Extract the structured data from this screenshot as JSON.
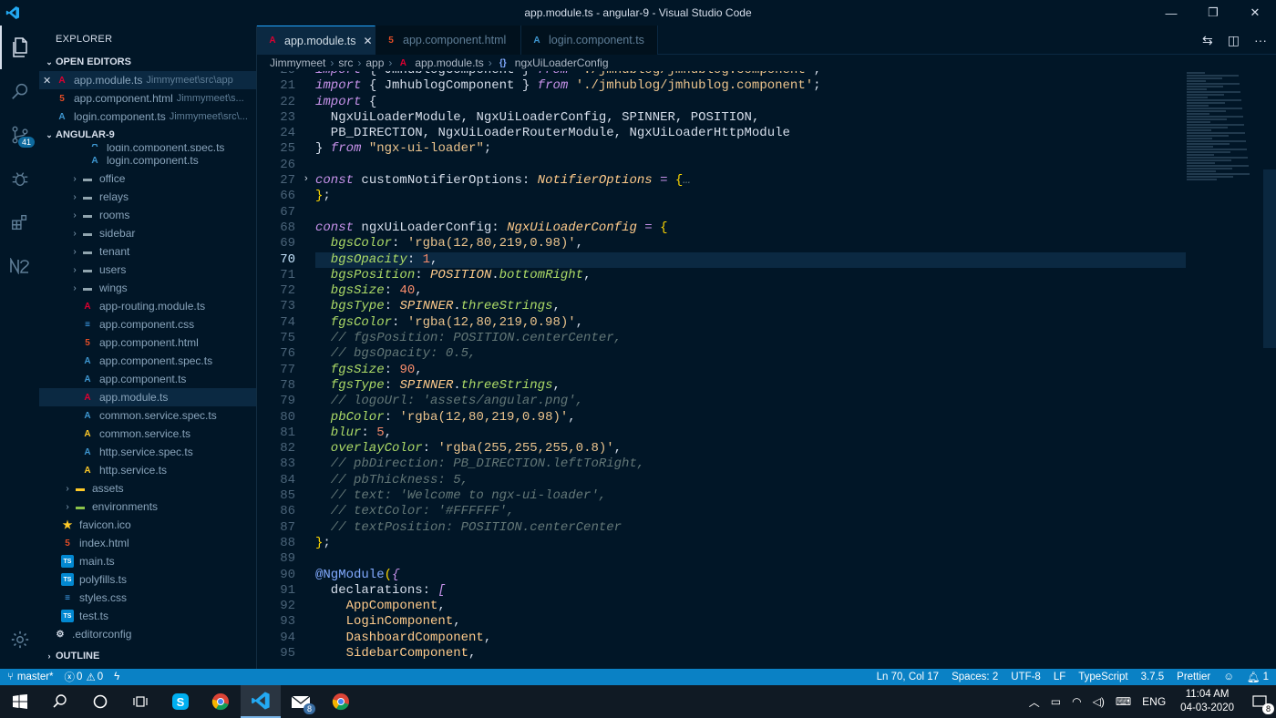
{
  "window": {
    "title": "app.module.ts - angular-9 - Visual Studio Code",
    "minimize": "—",
    "maximize": "❐",
    "close": "✕"
  },
  "activity": {
    "source_control_badge": "41"
  },
  "explorer": {
    "title": "EXPLORER",
    "open_editors_label": "OPEN EDITORS",
    "open_editors": [
      {
        "name": "app.module.ts",
        "path": "Jimmymeet\\src\\app",
        "icon": "angular-icon"
      },
      {
        "name": "app.component.html",
        "path": "Jimmymeet\\s...",
        "icon": "html-icon"
      },
      {
        "name": "login.component.ts",
        "path": "Jimmymeet\\src\\...",
        "icon": "angular-spec-icon"
      }
    ],
    "project_label": "ANGULAR-9",
    "tree": [
      {
        "name": "login.component.spec.ts",
        "indent": 3,
        "icon": "spec"
      },
      {
        "name": "login.component.ts",
        "indent": 3,
        "icon": "spec"
      },
      {
        "name": "office",
        "indent": 2,
        "icon": "folder"
      },
      {
        "name": "relays",
        "indent": 2,
        "icon": "folder"
      },
      {
        "name": "rooms",
        "indent": 2,
        "icon": "folder"
      },
      {
        "name": "sidebar",
        "indent": 2,
        "icon": "folder"
      },
      {
        "name": "tenant",
        "indent": 2,
        "icon": "folder"
      },
      {
        "name": "users",
        "indent": 2,
        "icon": "folder"
      },
      {
        "name": "wings",
        "indent": 2,
        "icon": "folder"
      },
      {
        "name": "app-routing.module.ts",
        "indent": 2,
        "icon": "ng"
      },
      {
        "name": "app.component.css",
        "indent": 2,
        "icon": "css"
      },
      {
        "name": "app.component.html",
        "indent": 2,
        "icon": "html"
      },
      {
        "name": "app.component.spec.ts",
        "indent": 2,
        "icon": "spec"
      },
      {
        "name": "app.component.ts",
        "indent": 2,
        "icon": "spec"
      },
      {
        "name": "app.module.ts",
        "indent": 2,
        "icon": "ng"
      },
      {
        "name": "common.service.spec.ts",
        "indent": 2,
        "icon": "spec"
      },
      {
        "name": "common.service.ts",
        "indent": 2,
        "icon": "svc"
      },
      {
        "name": "http.service.spec.ts",
        "indent": 2,
        "icon": "spec"
      },
      {
        "name": "http.service.ts",
        "indent": 2,
        "icon": "svc"
      },
      {
        "name": "assets",
        "indent": 1,
        "icon": "folder-y"
      },
      {
        "name": "environments",
        "indent": 1,
        "icon": "folder-g"
      },
      {
        "name": "favicon.ico",
        "indent": 1,
        "icon": "star"
      },
      {
        "name": "index.html",
        "indent": 1,
        "icon": "html"
      },
      {
        "name": "main.ts",
        "indent": 1,
        "icon": "ts"
      },
      {
        "name": "polyfills.ts",
        "indent": 1,
        "icon": "ts"
      },
      {
        "name": "styles.css",
        "indent": 1,
        "icon": "css"
      },
      {
        "name": "test.ts",
        "indent": 1,
        "icon": "ts"
      },
      {
        "name": ".editorconfig",
        "indent": 0,
        "icon": "gear"
      }
    ],
    "outline_label": "OUTLINE"
  },
  "tabs": [
    {
      "label": "app.module.ts",
      "icon": "angular-icon",
      "active": true
    },
    {
      "label": "app.component.html",
      "icon": "html-icon",
      "active": false
    },
    {
      "label": "login.component.ts",
      "icon": "angular-spec-icon",
      "active": false
    }
  ],
  "breadcrumbs": [
    "Jimmymeet",
    "src",
    "app",
    "app.module.ts",
    "ngxUiLoaderConfig"
  ],
  "editor": {
    "line_numbers": [
      "20",
      "21",
      "22",
      "23",
      "24",
      "25",
      "26",
      "27",
      "66",
      "67",
      "68",
      "69",
      "70",
      "71",
      "72",
      "73",
      "74",
      "75",
      "76",
      "77",
      "78",
      "79",
      "80",
      "81",
      "82",
      "83",
      "84",
      "85",
      "86",
      "87",
      "88",
      "89",
      "90",
      "91",
      "92",
      "93",
      "94",
      "95"
    ],
    "highlight_line_index": 12,
    "code": [
      [
        [
          "kw",
          "import "
        ],
        [
          "pu",
          "{ "
        ],
        [
          "v",
          "JmhublogComponent"
        ],
        [
          "pu",
          " } "
        ],
        [
          "kw",
          "from "
        ],
        [
          "str",
          "'./jmhublog/jmhublog.component'"
        ],
        [
          "pu",
          ";"
        ]
      ],
      [
        [
          "kw",
          "import "
        ],
        [
          "pu",
          "{ "
        ],
        [
          "v",
          "JmhublogComponent"
        ],
        [
          "pu",
          " } "
        ],
        [
          "kw",
          "from "
        ],
        [
          "str",
          "'./jmhublog/jmhublog.component'"
        ],
        [
          "pu",
          ";"
        ]
      ],
      [
        [
          "kw",
          "import "
        ],
        [
          "pu",
          "{"
        ]
      ],
      [
        [
          "v",
          "  NgxUiLoaderModule"
        ],
        [
          "pu",
          ", "
        ],
        [
          "v",
          "NgxUiLoaderConfig"
        ],
        [
          "pu",
          ", "
        ],
        [
          "v",
          "SPINNER"
        ],
        [
          "pu",
          ", "
        ],
        [
          "v",
          "POSITION"
        ],
        [
          "pu",
          ","
        ]
      ],
      [
        [
          "v",
          "  PB_DIRECTION"
        ],
        [
          "pu",
          ", "
        ],
        [
          "v",
          "NgxUiLoaderRouterModule"
        ],
        [
          "pu",
          ", "
        ],
        [
          "v",
          "NgxUiLoaderHttpModule"
        ]
      ],
      [
        [
          "pu",
          "} "
        ],
        [
          "kw",
          "from "
        ],
        [
          "str",
          "\"ngx-ui-loader\""
        ],
        [
          "pu",
          ";"
        ]
      ],
      [
        [
          "pu",
          ""
        ]
      ],
      [
        [
          "kw",
          "const "
        ],
        [
          "v",
          "customNotifierOptions"
        ],
        [
          "pu",
          ": "
        ],
        [
          "ty",
          "NotifierOptions"
        ],
        [
          "op",
          " = "
        ],
        [
          "br",
          "{"
        ],
        [
          "cm",
          "…"
        ]
      ],
      [
        [
          "br",
          "}"
        ],
        [
          "pu",
          ";"
        ]
      ],
      [
        [
          "pu",
          ""
        ]
      ],
      [
        [
          "kw",
          "const "
        ],
        [
          "v",
          "ngxUiLoaderConfig"
        ],
        [
          "pu",
          ": "
        ],
        [
          "ty",
          "NgxUiLoaderConfig"
        ],
        [
          "op",
          " = "
        ],
        [
          "br",
          "{"
        ]
      ],
      [
        [
          "pr",
          "  bgsColor"
        ],
        [
          "pu",
          ": "
        ],
        [
          "str",
          "'rgba(12,80,219,0.98)'"
        ],
        [
          "pu",
          ","
        ]
      ],
      [
        [
          "pr",
          "  bgsOpacity"
        ],
        [
          "pu",
          ": "
        ],
        [
          "num",
          "1"
        ],
        [
          "pu",
          ","
        ]
      ],
      [
        [
          "pr",
          "  bgsPosition"
        ],
        [
          "pu",
          ": "
        ],
        [
          "ty",
          "POSITION"
        ],
        [
          "pu",
          "."
        ],
        [
          "pr",
          "bottomRight"
        ],
        [
          "pu",
          ","
        ]
      ],
      [
        [
          "pr",
          "  bgsSize"
        ],
        [
          "pu",
          ": "
        ],
        [
          "num",
          "40"
        ],
        [
          "pu",
          ","
        ]
      ],
      [
        [
          "pr",
          "  bgsType"
        ],
        [
          "pu",
          ": "
        ],
        [
          "ty",
          "SPINNER"
        ],
        [
          "pu",
          "."
        ],
        [
          "pr",
          "threeStrings"
        ],
        [
          "pu",
          ","
        ]
      ],
      [
        [
          "pr",
          "  fgsColor"
        ],
        [
          "pu",
          ": "
        ],
        [
          "str",
          "'rgba(12,80,219,0.98)'"
        ],
        [
          "pu",
          ","
        ]
      ],
      [
        [
          "cm",
          "  // fgsPosition: POSITION.centerCenter,"
        ]
      ],
      [
        [
          "cm",
          "  // bgsOpacity: 0.5,"
        ]
      ],
      [
        [
          "pr",
          "  fgsSize"
        ],
        [
          "pu",
          ": "
        ],
        [
          "num",
          "90"
        ],
        [
          "pu",
          ","
        ]
      ],
      [
        [
          "pr",
          "  fgsType"
        ],
        [
          "pu",
          ": "
        ],
        [
          "ty",
          "SPINNER"
        ],
        [
          "pu",
          "."
        ],
        [
          "pr",
          "threeStrings"
        ],
        [
          "pu",
          ","
        ]
      ],
      [
        [
          "cm",
          "  // logoUrl: 'assets/angular.png',"
        ]
      ],
      [
        [
          "pr",
          "  pbColor"
        ],
        [
          "pu",
          ": "
        ],
        [
          "str",
          "'rgba(12,80,219,0.98)'"
        ],
        [
          "pu",
          ","
        ]
      ],
      [
        [
          "pr",
          "  blur"
        ],
        [
          "pu",
          ": "
        ],
        [
          "num",
          "5"
        ],
        [
          "pu",
          ","
        ]
      ],
      [
        [
          "pr",
          "  overlayColor"
        ],
        [
          "pu",
          ": "
        ],
        [
          "str",
          "'rgba(255,255,255,0.8)'"
        ],
        [
          "pu",
          ","
        ]
      ],
      [
        [
          "cm",
          "  // pbDirection: PB_DIRECTION.leftToRight,"
        ]
      ],
      [
        [
          "cm",
          "  // pbThickness: 5,"
        ]
      ],
      [
        [
          "cm",
          "  // text: 'Welcome to ngx-ui-loader',"
        ]
      ],
      [
        [
          "cm",
          "  // textColor: '#FFFFFF',"
        ]
      ],
      [
        [
          "cm",
          "  // textPosition: POSITION.centerCenter"
        ]
      ],
      [
        [
          "br",
          "}"
        ],
        [
          "pu",
          ";"
        ]
      ],
      [
        [
          "pu",
          ""
        ]
      ],
      [
        [
          "dec",
          "@NgModule"
        ],
        [
          "br",
          "("
        ],
        [
          "kw",
          "{"
        ]
      ],
      [
        [
          "v",
          "  declarations"
        ],
        [
          "pu",
          ": "
        ],
        [
          "kw",
          "["
        ]
      ],
      [
        [
          "cls",
          "    AppComponent"
        ],
        [
          "pu",
          ","
        ]
      ],
      [
        [
          "cls",
          "    LoginComponent"
        ],
        [
          "pu",
          ","
        ]
      ],
      [
        [
          "cls",
          "    DashboardComponent"
        ],
        [
          "pu",
          ","
        ]
      ],
      [
        [
          "cls",
          "    SidebarComponent"
        ],
        [
          "pu",
          ","
        ]
      ]
    ]
  },
  "status": {
    "branch": "master*",
    "errors": "0",
    "warnings": "0",
    "position": "Ln 70, Col 17",
    "spaces": "Spaces: 2",
    "encoding": "UTF-8",
    "eol": "LF",
    "language": "TypeScript",
    "version": "3.7.5",
    "formatter": "Prettier",
    "notifications": "1"
  },
  "taskbar": {
    "language": "ENG",
    "time": "11:04 AM",
    "date": "04-03-2020",
    "notification_count": "8",
    "mail_badge": "8"
  },
  "colors": {
    "accent": "#0a81c5",
    "background": "#011627"
  }
}
